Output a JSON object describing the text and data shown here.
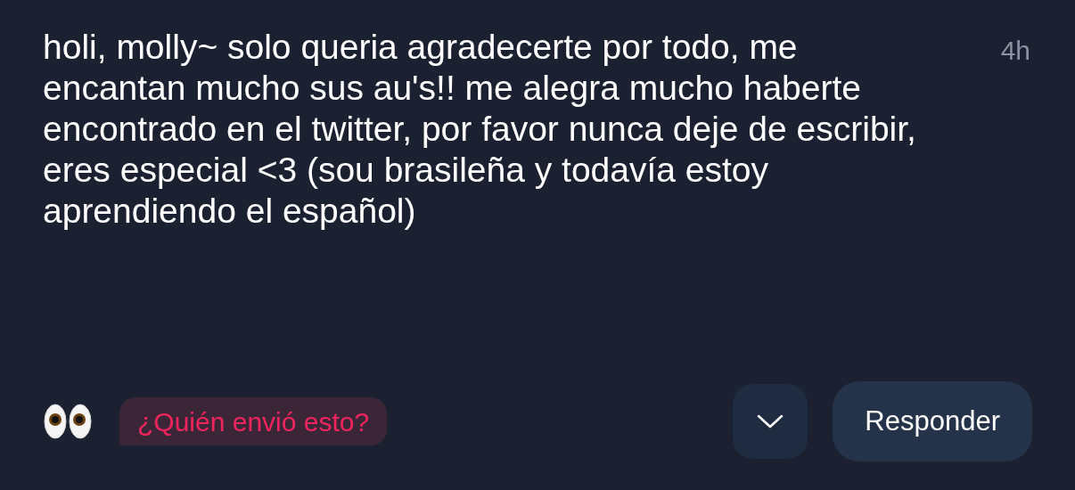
{
  "message": {
    "text": "holi, molly~ solo queria agradecerte por todo, me encantan mucho sus au's!! me alegra mucho haberte encontrado en el twitter, por favor nunca deje de escribir, eres especial <3 (sou brasileña y todavía estoy aprendiendo el español)",
    "time": "4h"
  },
  "sender_prompt": "¿Quién envió esto?",
  "buttons": [
    "Responder"
  ]
}
